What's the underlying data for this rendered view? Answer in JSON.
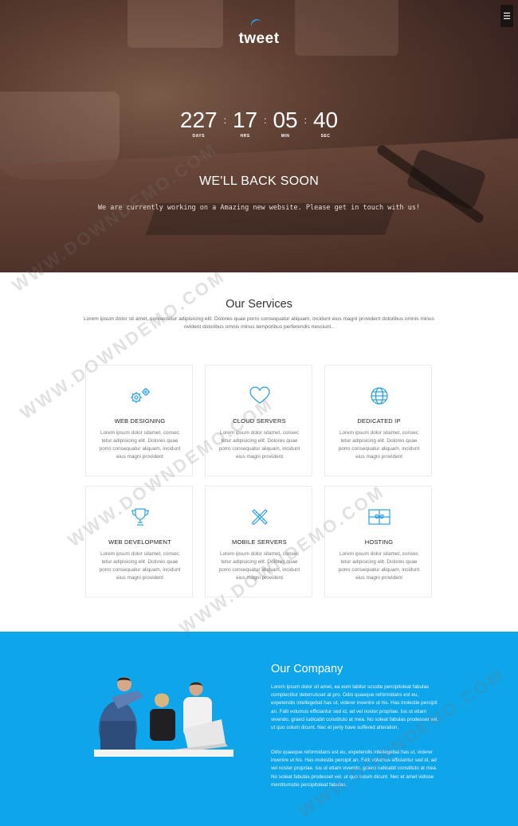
{
  "header": {
    "logo_text": "tweet",
    "menu_icon": "menu-icon"
  },
  "countdown": {
    "days": "227",
    "days_label": "DAYS",
    "hours": "17",
    "hours_label": "HRS",
    "minutes": "05",
    "minutes_label": "MIN",
    "seconds": "40",
    "seconds_label": "SEC",
    "separator": ":"
  },
  "hero": {
    "title": "WE'LL BACK SOON",
    "subtitle": "We are currently working on a Amazing new website. Please get in touch with us!"
  },
  "services": {
    "title": "Our Services",
    "description": "Lorem ipsum dolor sit amet, consectetur adipisicing elit. Dolores quae porro consequatur aliquam, incidunt eius magni provident doloribus omnis minus ovident doloribus omnis minus temporibus perferendis nesciunt..",
    "items": [
      {
        "title": "WEB DESIGNING",
        "icon": "gears-icon",
        "text": "Lorem ipsum dolor sitamet, consec tetur adipisicing elit. Dolores quae porro consequatur aliquam, incidunt eius magni provident"
      },
      {
        "title": "CLOUD SERVERS",
        "icon": "heart-icon",
        "text": "Lorem ipsum dolor sitamet, consec tetur adipisicing elit. Dolores quae porro consequatur aliquam, incidunt eius magni provident"
      },
      {
        "title": "DEDICATED IP",
        "icon": "globe-icon",
        "text": "Lorem ipsum dolor sitamet, consec tetur adipisicing elit. Dolores quae porro consequatur aliquam, incidunt eius magni provident"
      },
      {
        "title": "WEB DEVELOPMENT",
        "icon": "trophy-icon",
        "text": "Lorem ipsum dolor sitamet, consec tetur adipisicing elit. Dolores quae porro consequatur aliquam, incidunt eius magni provident"
      },
      {
        "title": "MOBILE SERVERS",
        "icon": "pencil-ruler-icon",
        "text": "Lorem ipsum dolor sitamet, consec tetur adipisicing elit. Dolores quae porro consequatur aliquam, incidunt eius magni provident"
      },
      {
        "title": "HOSTING",
        "icon": "gift-icon",
        "text": "Lorem ipsum dolor sitamet, consec tetur adipisicing elit. Dolores quae porro consequatur aliquam, incidunt eius magni provident"
      }
    ]
  },
  "company": {
    "title": "Our Company",
    "paragraph1": "Lorem ipsum dolor sit amet, ea eum labitur scsstie percipitoleat fabulas complectitur deterruisset at pro. Odio quaeque reformidans est eu, expetendis intellegebat has ut, viderer invenire ut his. Has molestie percipit an. Falli volumus efficiantur sed id, ad vel noster propriae. Ius ut etiam vivendo, graeci iudicabit constituto at mea. No soleat fabulas prodesset vel, ut quo solum dicunt. Nec et jerily have suffered alteration.",
    "paragraph2": "Odio quaeque reformidans est eu, expetendis intellegebat has ut, viderer invenire ut his. Has molestie percipit an. Falli volumus efficiantur sed id, ad vel noster propriae. Ius ut etiam vivendo, graeci iudicabit constituto at mea. No soleat fabulas prodesset vel, ut quo solum dicunt. Nec et amet vidisse mentitumstie percipitoleat fabulas."
  },
  "watermark": {
    "text": "WWW.DOWNDEMO.COM"
  },
  "colors": {
    "accent": "#0ea5ea",
    "icon": "#2aa0e6",
    "hero_dark": "#3a2420"
  }
}
